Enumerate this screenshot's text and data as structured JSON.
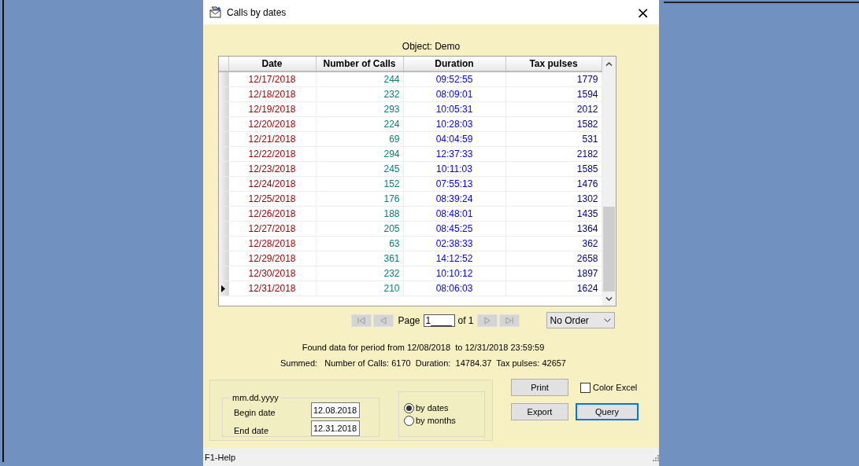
{
  "window": {
    "title": "Calls by dates",
    "close": "×"
  },
  "object_label": "Object: Demo",
  "table": {
    "columns": [
      "Date",
      "Number of Calls",
      "Duration",
      "Tax pulses"
    ],
    "rows": [
      {
        "date": "12/17/2018",
        "calls": "244",
        "duration": "09:52:55",
        "tax": "1779",
        "selected": false
      },
      {
        "date": "12/18/2018",
        "calls": "232",
        "duration": "08:09:01",
        "tax": "1594",
        "selected": false
      },
      {
        "date": "12/19/2018",
        "calls": "293",
        "duration": "10:05:31",
        "tax": "2012",
        "selected": false
      },
      {
        "date": "12/20/2018",
        "calls": "224",
        "duration": "10:28:03",
        "tax": "1582",
        "selected": false
      },
      {
        "date": "12/21/2018",
        "calls": "69",
        "duration": "04:04:59",
        "tax": "531",
        "selected": false
      },
      {
        "date": "12/22/2018",
        "calls": "294",
        "duration": "12:37:33",
        "tax": "2182",
        "selected": false
      },
      {
        "date": "12/23/2018",
        "calls": "245",
        "duration": "10:11:03",
        "tax": "1585",
        "selected": false
      },
      {
        "date": "12/24/2018",
        "calls": "152",
        "duration": "07:55:13",
        "tax": "1476",
        "selected": false
      },
      {
        "date": "12/25/2018",
        "calls": "176",
        "duration": "08:39:24",
        "tax": "1302",
        "selected": false
      },
      {
        "date": "12/26/2018",
        "calls": "188",
        "duration": "08:48:01",
        "tax": "1435",
        "selected": false
      },
      {
        "date": "12/27/2018",
        "calls": "205",
        "duration": "08:45:25",
        "tax": "1364",
        "selected": false
      },
      {
        "date": "12/28/2018",
        "calls": "63",
        "duration": "02:38:33",
        "tax": "362",
        "selected": false
      },
      {
        "date": "12/29/2018",
        "calls": "361",
        "duration": "14:12:52",
        "tax": "2658",
        "selected": false
      },
      {
        "date": "12/30/2018",
        "calls": "232",
        "duration": "10:10:12",
        "tax": "1897",
        "selected": false
      },
      {
        "date": "12/31/2018",
        "calls": "210",
        "duration": "08:06:03",
        "tax": "1624",
        "selected": true
      }
    ]
  },
  "pager": {
    "page_label": "Page",
    "page_value": "1____",
    "of_label": "of 1"
  },
  "order_select": {
    "value": "No Order"
  },
  "period_text": "Found data for period from 12/08/2018  to 12/31/2018 23:59:59",
  "summary_text": "Summed:   Number of Calls: 6170  Duration:  14784.37  Tax pulses: 42657",
  "date_group": {
    "legend": "mm.dd.yyyy",
    "fields": [
      {
        "label": "Begin date",
        "value": "12.08.2018"
      },
      {
        "label": "End date",
        "value": "12.31.2018"
      }
    ]
  },
  "mode_radios": [
    {
      "label": "by dates",
      "selected": true
    },
    {
      "label": "by months",
      "selected": false
    }
  ],
  "buttons": {
    "print": "Print",
    "export": "Export",
    "query": "Query"
  },
  "color_excel": {
    "label": "Color Excel",
    "checked": false
  },
  "status_bar": "F1-Help"
}
